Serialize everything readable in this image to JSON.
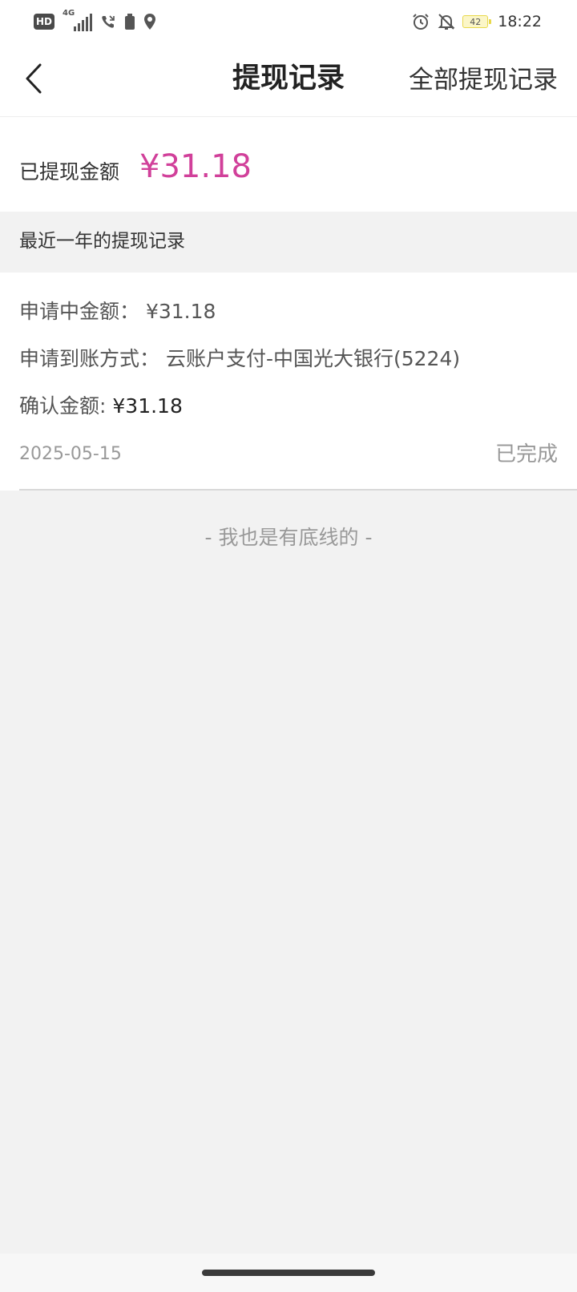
{
  "status_bar": {
    "hd_label": "HD",
    "network_label": "4G",
    "battery_level": "42",
    "time": "18:22",
    "icons": [
      "signal-icon",
      "wifi-calling-icon",
      "battery-small-icon",
      "location-icon",
      "alarm-icon",
      "mute-bell-icon"
    ]
  },
  "header": {
    "title": "提现记录",
    "all_records_label": "全部提现记录",
    "back_icon": "chevron-left-icon"
  },
  "summary": {
    "label": "已提现金额",
    "amount": "¥31.18",
    "accent_color": "#d1409a"
  },
  "section": {
    "title": "最近一年的提现记录"
  },
  "records": [
    {
      "applying_amount_label": "申请中金额：",
      "applying_amount": "¥31.18",
      "method_label": "申请到账方式：",
      "method": "云账户支付-中国光大银行(5224)",
      "confirmed_amount_label": "确认金额:",
      "confirmed_amount": "¥31.18",
      "date": "2025-05-15",
      "status": "已完成"
    }
  ],
  "footer": {
    "end_note": "- 我也是有底线的 -"
  }
}
